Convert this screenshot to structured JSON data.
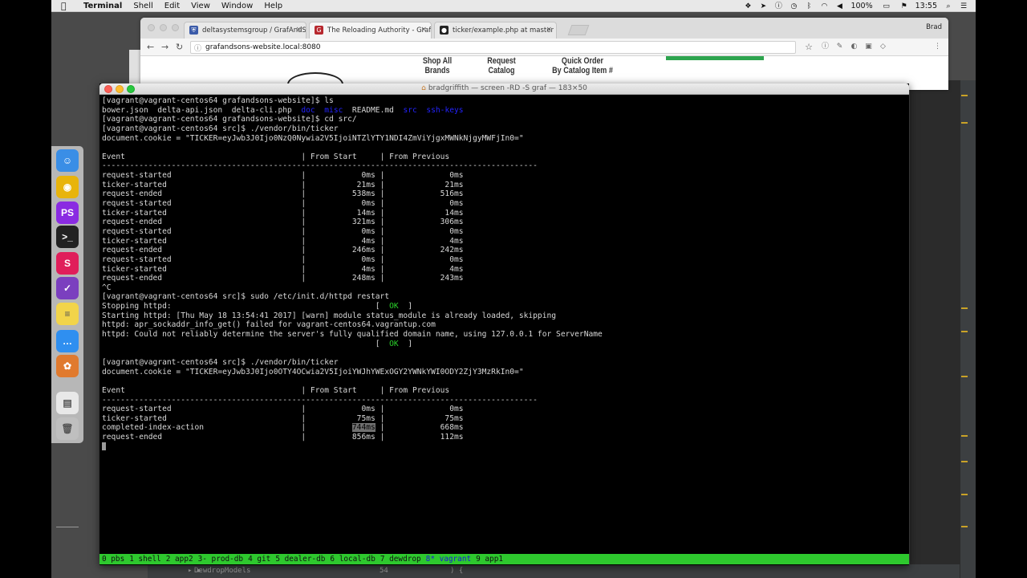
{
  "menubar": {
    "apple": "",
    "app": "Terminal",
    "items": [
      "Shell",
      "Edit",
      "View",
      "Window",
      "Help"
    ],
    "battery": "100%",
    "time": "13:55"
  },
  "browser": {
    "tabs": [
      {
        "title": "deltasystemsgroup / GrafAndS",
        "icon": "shield-icon",
        "color": "#3b5ba9"
      },
      {
        "title": "The Reloading Authority - Graf",
        "icon": "graf-logo-icon",
        "color": "#b7282e"
      },
      {
        "title": "ticker/example.php at master",
        "icon": "github-icon",
        "color": "#222222"
      }
    ],
    "profile": "Brad",
    "url": "grafandsons-website.local:8080",
    "page_nav": [
      {
        "line1": "Shop All",
        "line2": "Brands"
      },
      {
        "line1": "Request",
        "line2": "Catalog"
      },
      {
        "line1": "Quick Order",
        "line2": "By Catalog Item #"
      }
    ]
  },
  "terminal": {
    "title": "bradgriffith — screen -RD -S graf — 183×50",
    "lines": [
      [
        {
          "t": "[vagrant@vagrant-centos64 grafandsons-website]$ ls"
        }
      ],
      [
        {
          "t": "bower.json  delta-api.json  delta-cli.php  "
        },
        {
          "t": "doc",
          "c": "c-blue"
        },
        {
          "t": "  "
        },
        {
          "t": "misc",
          "c": "c-blue"
        },
        {
          "t": "  README.md  "
        },
        {
          "t": "src",
          "c": "c-blue"
        },
        {
          "t": "  "
        },
        {
          "t": "ssh-keys",
          "c": "c-blue"
        }
      ],
      [
        {
          "t": "[vagrant@vagrant-centos64 grafandsons-website]$ cd src/"
        }
      ],
      [
        {
          "t": "[vagrant@vagrant-centos64 src]$ ./vendor/bin/ticker"
        }
      ],
      [
        {
          "t": "document.cookie = \"TICKER=eyJwb3J0Ijo0NzQ0Nywia2V5IjoiNTZlYTY1NDI4ZmViYjgxMWNkNjgyMWFjIn0=\""
        }
      ],
      [
        {
          "t": ""
        }
      ],
      [
        {
          "t": "Event                                      | From Start     | From Previous"
        }
      ],
      [
        {
          "t": "----------------------------------------------------------------------------------------------"
        }
      ],
      [
        {
          "t": "request-started                            |            0ms |              0ms"
        }
      ],
      [
        {
          "t": "ticker-started                             |           21ms |             21ms"
        }
      ],
      [
        {
          "t": "request-ended                              |          538ms |            516ms"
        }
      ],
      [
        {
          "t": "request-started                            |            0ms |              0ms"
        }
      ],
      [
        {
          "t": "ticker-started                             |           14ms |             14ms"
        }
      ],
      [
        {
          "t": "request-ended                              |          321ms |            306ms"
        }
      ],
      [
        {
          "t": "request-started                            |            0ms |              0ms"
        }
      ],
      [
        {
          "t": "ticker-started                             |            4ms |              4ms"
        }
      ],
      [
        {
          "t": "request-ended                              |          246ms |            242ms"
        }
      ],
      [
        {
          "t": "request-started                            |            0ms |              0ms"
        }
      ],
      [
        {
          "t": "ticker-started                             |            4ms |              4ms"
        }
      ],
      [
        {
          "t": "request-ended                              |          248ms |            243ms"
        }
      ],
      [
        {
          "t": "^C"
        }
      ],
      [
        {
          "t": "[vagrant@vagrant-centos64 src]$ sudo /etc/init.d/httpd restart"
        }
      ],
      [
        {
          "t": "Stopping httpd:                                            [  "
        },
        {
          "t": "OK",
          "c": "c-green"
        },
        {
          "t": "  ]"
        }
      ],
      [
        {
          "t": "Starting httpd: [Thu May 18 13:54:41 2017] [warn] module status_module is already loaded, skipping"
        }
      ],
      [
        {
          "t": "httpd: apr_sockaddr_info_get() failed for vagrant-centos64.vagrantup.com"
        }
      ],
      [
        {
          "t": "httpd: Could not reliably determine the server's fully qualified domain name, using 127.0.0.1 for ServerName"
        }
      ],
      [
        {
          "t": "                                                           [  "
        },
        {
          "t": "OK",
          "c": "c-green"
        },
        {
          "t": "  ]"
        }
      ],
      [
        {
          "t": ""
        }
      ],
      [
        {
          "t": "[vagrant@vagrant-centos64 src]$ ./vendor/bin/ticker"
        }
      ],
      [
        {
          "t": "document.cookie = \"TICKER=eyJwb3J0Ijo0OTY4OCwia2V5IjoiYWJhYWExOGY2YWNkYWI0ODY2ZjY3MzRkIn0=\""
        }
      ],
      [
        {
          "t": ""
        }
      ],
      [
        {
          "t": "Event                                      | From Start     | From Previous"
        }
      ],
      [
        {
          "t": "----------------------------------------------------------------------------------------------"
        }
      ],
      [
        {
          "t": "request-started                            |            0ms |              0ms"
        }
      ],
      [
        {
          "t": "ticker-started                             |           75ms |             75ms"
        }
      ],
      [
        {
          "t": "completed-index-action                     |          "
        },
        {
          "t": "744ms",
          "c": "hl"
        },
        {
          "t": " |            668ms"
        }
      ],
      [
        {
          "t": "request-ended                              |          856ms |            112ms"
        }
      ]
    ],
    "status_windows": [
      {
        "label": "0 pbs"
      },
      {
        "label": "1 shell"
      },
      {
        "label": "2 app2"
      },
      {
        "label": "3- prod-db"
      },
      {
        "label": "4 git"
      },
      {
        "label": "5 dealer-db"
      },
      {
        "label": "6 local-db"
      },
      {
        "label": "7 dewdrop"
      },
      {
        "label": "8* vagrant",
        "current": true
      },
      {
        "label": "9 app1"
      }
    ]
  },
  "ide": {
    "tree_item": "DewdropModels",
    "line_no": "54",
    "code": ") {"
  },
  "dock": [
    {
      "name": "finder-icon",
      "color": "#3a8ee6",
      "glyph": "☺"
    },
    {
      "name": "chrome-icon",
      "color": "#e8b40c",
      "glyph": "◉"
    },
    {
      "name": "phpstorm-icon",
      "color": "#8a2be2",
      "glyph": "PS"
    },
    {
      "name": "terminal-icon",
      "color": "#222222",
      "glyph": ">_"
    },
    {
      "name": "slack-icon",
      "color": "#e01e5a",
      "glyph": "S"
    },
    {
      "name": "omnifocus-icon",
      "color": "#7b3fbf",
      "glyph": "✓"
    },
    {
      "name": "notes-icon",
      "color": "#f2d44a",
      "glyph": "≡"
    },
    {
      "name": "messages-icon",
      "color": "#2f8ff0",
      "glyph": "…"
    },
    {
      "name": "app-icon",
      "color": "#e07a2e",
      "glyph": "✿"
    },
    {
      "name": "document-icon",
      "color": "#e8e8e8",
      "glyph": "▤"
    },
    {
      "name": "trash-icon",
      "color": "#bfbfbf",
      "glyph": "🗑"
    }
  ]
}
